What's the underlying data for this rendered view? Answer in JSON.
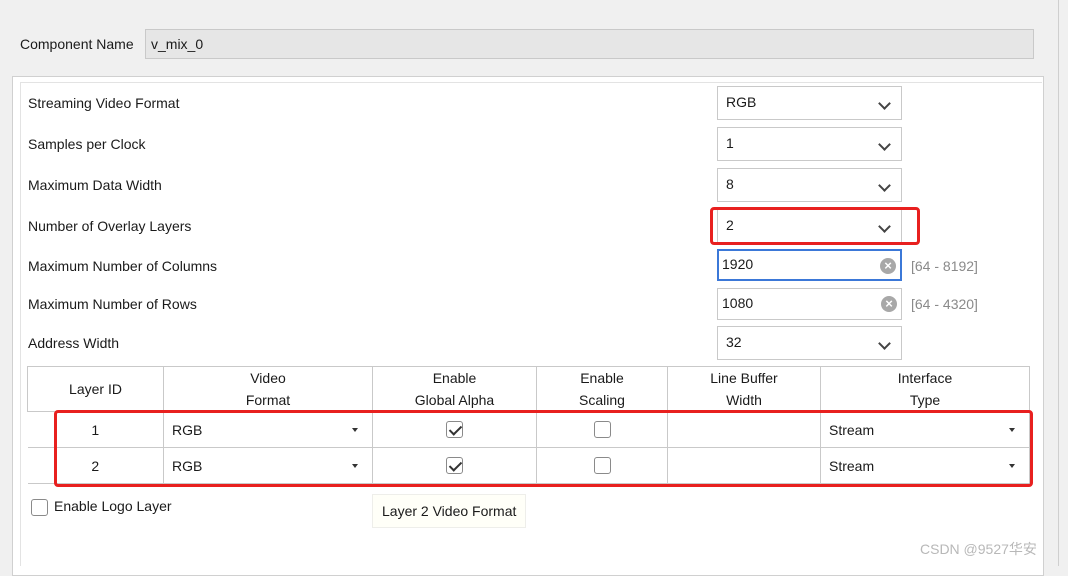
{
  "component": {
    "label": "Component Name",
    "value": "v_mix_0"
  },
  "fields": {
    "streaming_video_format": {
      "label": "Streaming Video Format",
      "value": "RGB"
    },
    "samples_per_clock": {
      "label": "Samples per Clock",
      "value": "1"
    },
    "maximum_data_width": {
      "label": "Maximum Data Width",
      "value": "8"
    },
    "number_of_overlay_layers": {
      "label": "Number of Overlay Layers",
      "value": "2"
    },
    "maximum_number_of_columns": {
      "label": "Maximum Number of Columns",
      "value": "1920",
      "range": "[64 - 8192]"
    },
    "maximum_number_of_rows": {
      "label": "Maximum Number of Rows",
      "value": "1080",
      "range": "[64 - 4320]"
    },
    "address_width": {
      "label": "Address Width",
      "value": "32"
    }
  },
  "table": {
    "headers": [
      {
        "line1": "Layer ID",
        "line2": ""
      },
      {
        "line1": "Video",
        "line2": "Format"
      },
      {
        "line1": "Enable",
        "line2": "Global Alpha"
      },
      {
        "line1": "Enable",
        "line2": "Scaling"
      },
      {
        "line1": "Line Buffer",
        "line2": "Width"
      },
      {
        "line1": "Interface",
        "line2": "Type"
      }
    ],
    "rows": [
      {
        "layer_id": "1",
        "video_format": "RGB",
        "global_alpha": true,
        "scaling": false,
        "line_buffer_width": "",
        "interface_type": "Stream"
      },
      {
        "layer_id": "2",
        "video_format": "RGB",
        "global_alpha": true,
        "scaling": false,
        "line_buffer_width": "",
        "interface_type": "Stream"
      }
    ]
  },
  "logo_layer": {
    "label": "Enable Logo Layer",
    "checked": false
  },
  "tooltip": "Layer 2 Video Format",
  "watermark": "CSDN @9527华安",
  "colors": {
    "highlight": "#e8201f",
    "focus": "#3b78d8"
  }
}
